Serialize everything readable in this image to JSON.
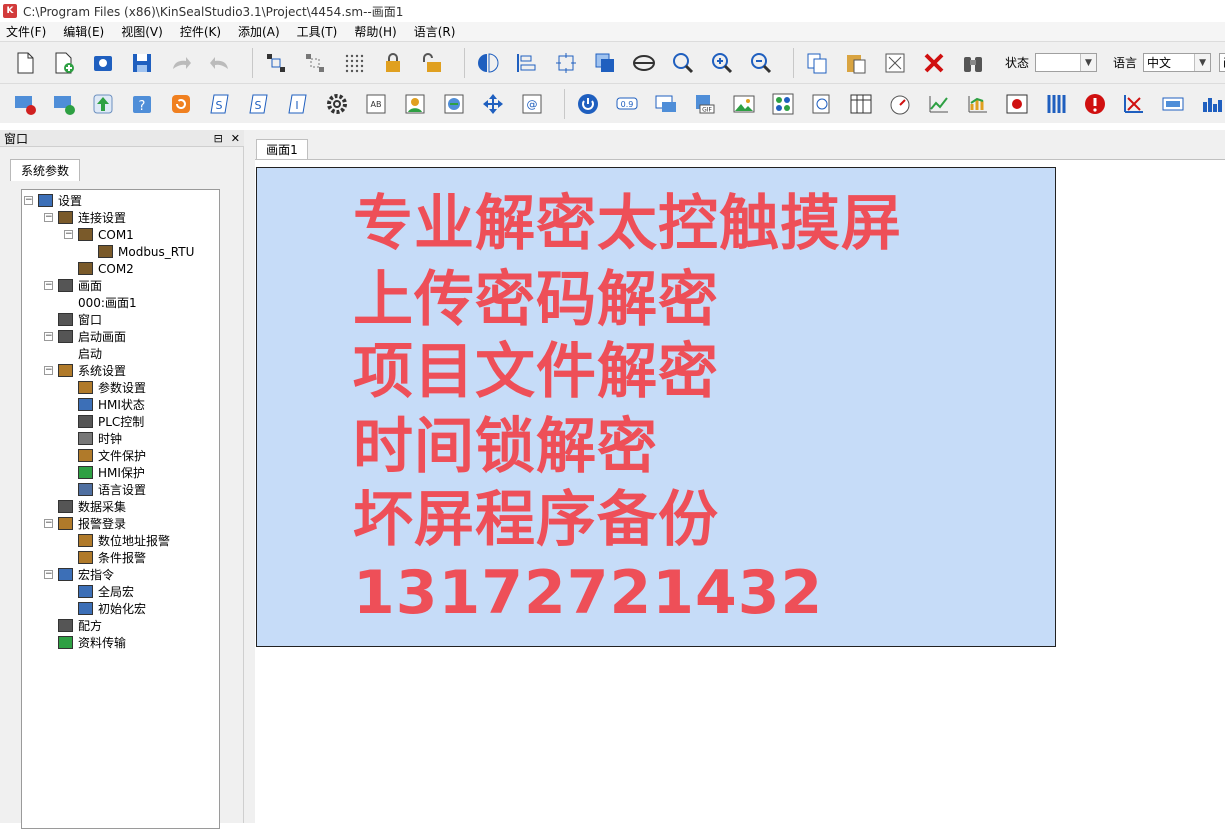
{
  "window": {
    "title": "C:\\Program Files (x86)\\KinSealStudio3.1\\Project\\4454.sm--画面1"
  },
  "menu": [
    "文件(F)",
    "编辑(E)",
    "视图(V)",
    "控件(K)",
    "添加(A)",
    "工具(T)",
    "帮助(H)",
    "语言(R)"
  ],
  "toolbar": {
    "state_label": "状态",
    "state_value": "",
    "language_label": "语言",
    "language_value": "中文",
    "screen_value": "画面"
  },
  "panel": {
    "title": "窗口",
    "tab": "系统参数",
    "tree": [
      {
        "label": "设置"
      },
      {
        "label": "连接设置"
      },
      {
        "label": "COM1"
      },
      {
        "label": "Modbus_RTU"
      },
      {
        "label": "COM2"
      },
      {
        "label": "画面"
      },
      {
        "label": "000:画面1"
      },
      {
        "label": "窗口"
      },
      {
        "label": "启动画面"
      },
      {
        "label": "启动"
      },
      {
        "label": "系统设置"
      },
      {
        "label": "参数设置"
      },
      {
        "label": "HMI状态"
      },
      {
        "label": "PLC控制"
      },
      {
        "label": "时钟"
      },
      {
        "label": "文件保护"
      },
      {
        "label": "HMI保护"
      },
      {
        "label": "语言设置"
      },
      {
        "label": "数据采集"
      },
      {
        "label": "报警登录"
      },
      {
        "label": "数位地址报警"
      },
      {
        "label": "条件报警"
      },
      {
        "label": "宏指令"
      },
      {
        "label": "全局宏"
      },
      {
        "label": "初始化宏"
      },
      {
        "label": "配方"
      },
      {
        "label": "资料传输"
      }
    ]
  },
  "document": {
    "tab": "画面1",
    "lines": [
      "专业解密太控触摸屏",
      "上传密码解密",
      "项目文件解密",
      "时间锁解密",
      "坏屏程序备份",
      "13172721432"
    ]
  },
  "colors": {
    "screen_bg": "#c6dcf8",
    "promo_text": "#ee4f58"
  }
}
